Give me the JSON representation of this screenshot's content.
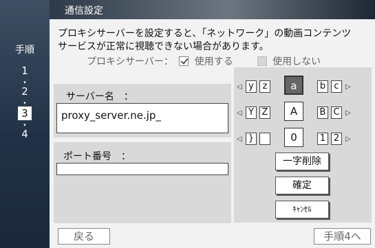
{
  "header": {
    "title": "通信設定"
  },
  "steps": {
    "title": "手順",
    "items": [
      "1",
      "2",
      "3",
      "4"
    ],
    "active": "3"
  },
  "description": {
    "line1": "プロキシサーバーを設定すると、「ネットワーク」の動画コンテンツ",
    "line2": "サービスが正常に視聴できない場合があります。"
  },
  "proxy": {
    "label": "プロキシサーバー：",
    "use_label": "使用する",
    "use_checked": true,
    "nouse_label": "使用しない",
    "nouse_checked": false
  },
  "server": {
    "label": "サーバー名　：",
    "value": "proxy_server.ne.jp_"
  },
  "port": {
    "label": "ポート番号　：",
    "value": ""
  },
  "keyboard": {
    "row1": [
      "y",
      "z",
      "a",
      "b",
      "c"
    ],
    "row2": [
      "Y",
      "Z",
      "A",
      "B",
      "C"
    ],
    "row3": [
      "}",
      "",
      "0",
      "1",
      "2"
    ],
    "selected_key": "a",
    "delete_label": "一字削除",
    "confirm_label": "確定",
    "cancel_label": "ｷｬﾝｾﾙ"
  },
  "footer": {
    "back_label": "戻る",
    "next_label": "手順4へ"
  }
}
